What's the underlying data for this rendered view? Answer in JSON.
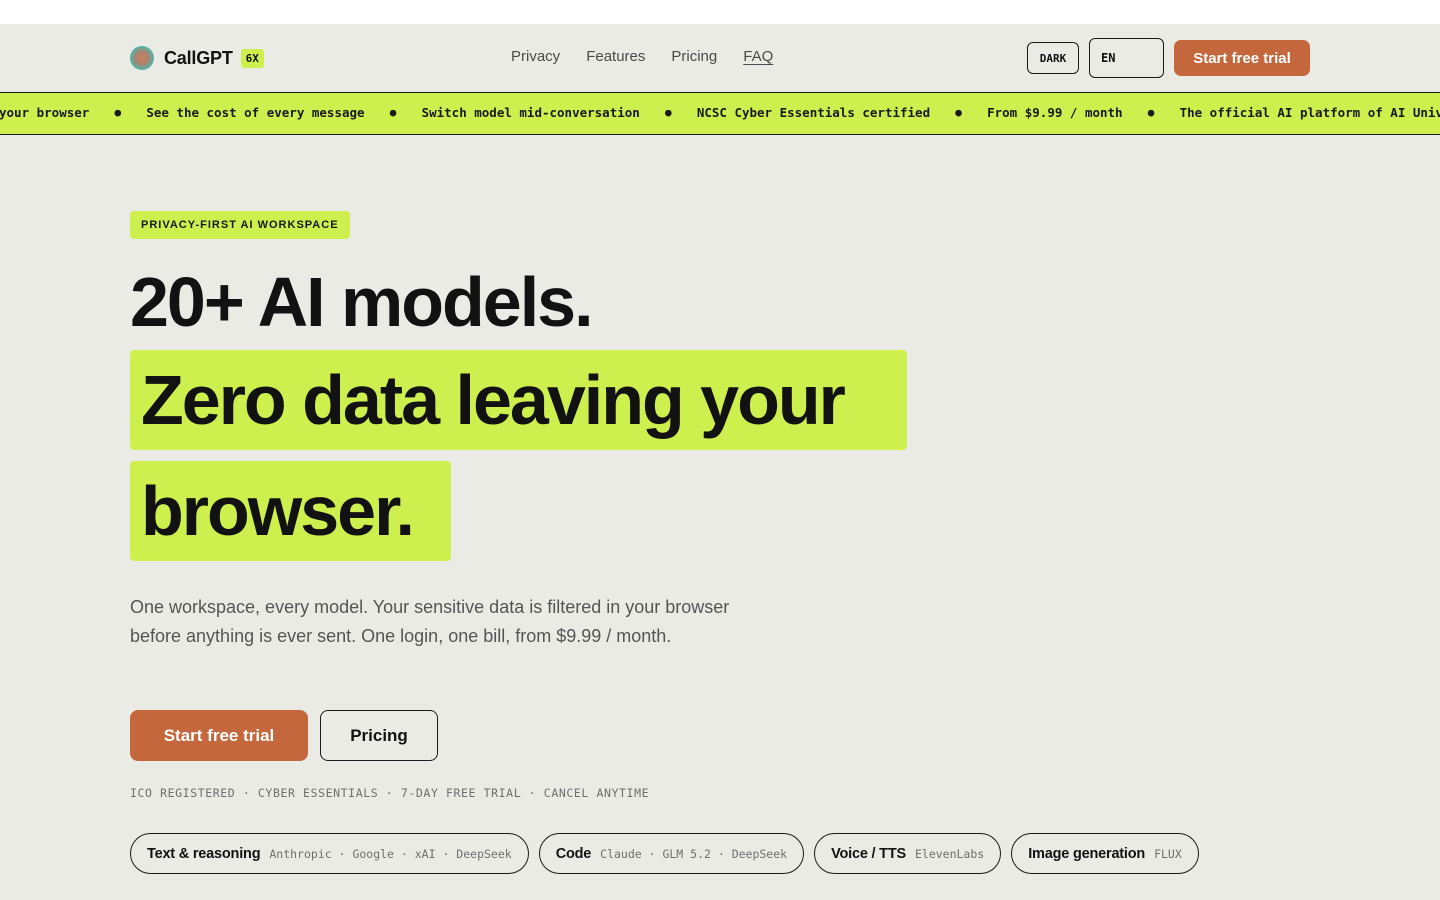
{
  "header": {
    "brand_name": "CallGPT",
    "brand_badge": "6X",
    "nav": [
      "Privacy",
      "Features",
      "Pricing",
      "FAQ"
    ],
    "theme_toggle_label": "DARK",
    "language_value": "EN",
    "cta_label": "Start free trial"
  },
  "ticker": {
    "items": [
      "your browser",
      "See the cost of every message",
      "Switch model mid-conversation",
      "NCSC Cyber Essentials certified",
      "From $9.99 / month",
      "The official AI platform of AI Univ"
    ],
    "separator": "●"
  },
  "hero": {
    "eyebrow": "PRIVACY-FIRST AI WORKSPACE",
    "headline_line1": "20+ AI models.",
    "headline_highlight1": "Zero data leaving your",
    "headline_highlight2": "browser.",
    "lead": "One workspace, every model. Your sensitive data is filtered in your browser before anything is ever sent. One login, one bill, from $9.99 / month.",
    "primary_cta": "Start free trial",
    "secondary_cta": "Pricing",
    "trust_line": "ICO REGISTERED · CYBER ESSENTIALS · 7-DAY FREE TRIAL · CANCEL ANYTIME",
    "chips": [
      {
        "label": "Text & reasoning",
        "detail": "Anthropic · Google · xAI · DeepSeek"
      },
      {
        "label": "Code",
        "detail": "Claude · GLM 5.2 · DeepSeek"
      },
      {
        "label": "Voice / TTS",
        "detail": "ElevenLabs"
      },
      {
        "label": "Image generation",
        "detail": "FLUX"
      }
    ]
  },
  "colors": {
    "background": "#ebebe6",
    "accent_lime": "#cdf04f",
    "cta_orange": "#c4673c",
    "ink": "#121212"
  }
}
